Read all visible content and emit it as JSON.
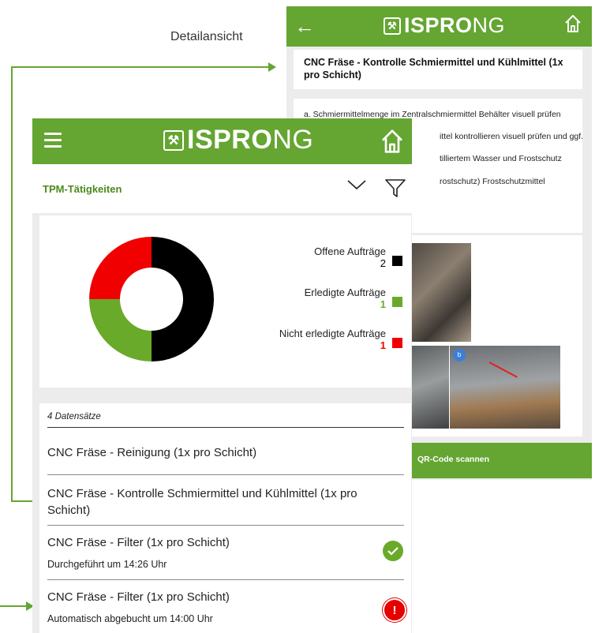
{
  "caption": "Detailansicht",
  "brand": {
    "logo_text": "ISPRO",
    "logo_suffix": "NG",
    "green": "#65a532"
  },
  "detail_screen": {
    "back_icon": "arrow-left-icon",
    "home_icon": "home-icon",
    "title": "CNC Fräse - Kontrolle Schmiermittel und Kühlmittel (1x pro Schicht)",
    "steps": [
      "a. Schmiermittelmenge im Zentralschmiermittel Behälter visuell prüfen",
      "ittel kontrollieren visuell prüfen und ggf.",
      "tilliertem Wasser und Frostschutz",
      "rostschutz) Frostschutzmittel"
    ],
    "photo_badge": "b",
    "footer_button": "QR-Code scannen"
  },
  "list_screen": {
    "menu_icon": "hamburger-menu-icon",
    "home_icon": "home-icon",
    "filter_title": "TPM-Tätigkeiten",
    "chart_data": {
      "type": "pie",
      "categories": [
        "Offene Aufträge",
        "Erledigte Aufträge",
        "Nicht erledigte Aufträge"
      ],
      "values": [
        2,
        1,
        1
      ],
      "colors": [
        "#000000",
        "#6aaa2a",
        "#f00000"
      ],
      "legend_placement": "right"
    },
    "legend": [
      {
        "label": "Offene Aufträge",
        "value": "2",
        "color": "#000000"
      },
      {
        "label": "Erledigte Aufträge",
        "value": "1",
        "color": "#6aaa2a"
      },
      {
        "label": "Nicht erledigte Aufträge",
        "value": "1",
        "color": "#f00000"
      }
    ],
    "record_count": "4 Datensätze",
    "items": [
      {
        "title": "CNC Fräse - Reinigung (1x pro Schicht)"
      },
      {
        "title": "CNC Fräse - Kontrolle Schmiermittel und Kühlmittel (1x pro Schicht)"
      },
      {
        "title": "CNC Fräse - Filter (1x pro Schicht)",
        "subtitle": "Durchgeführt um 14:26 Uhr",
        "status": "done",
        "status_color": "#6aaa2a"
      },
      {
        "title": "CNC Fräse - Filter (1x pro Schicht)",
        "subtitle": "Automatisch abgebucht um 14:00 Uhr",
        "status": "error",
        "status_color": "#e60000"
      }
    ]
  }
}
